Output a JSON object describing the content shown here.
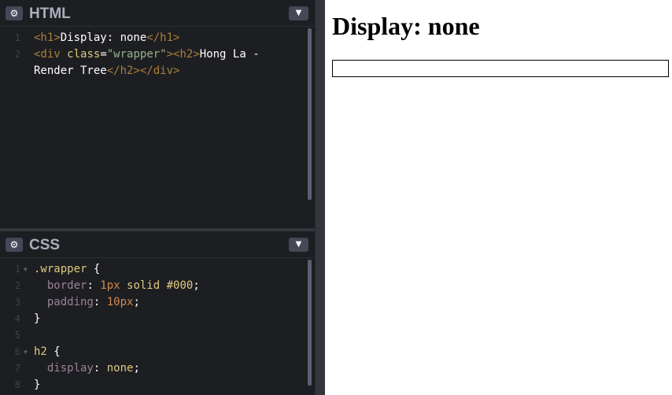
{
  "html_panel": {
    "title": "HTML",
    "gear_icon": "gear-icon",
    "collapse_icon": "chevron-down-icon",
    "lines": [
      {
        "n": "1",
        "segments": [
          {
            "t": "<h1>",
            "c": "tag"
          },
          {
            "t": "Display: none",
            "c": "txt"
          },
          {
            "t": "</h1>",
            "c": "tag"
          }
        ]
      },
      {
        "n": "2",
        "segments": [
          {
            "t": "<div ",
            "c": "tag"
          },
          {
            "t": "class",
            "c": "attr"
          },
          {
            "t": "=",
            "c": "punc"
          },
          {
            "t": "\"wrapper\"",
            "c": "str"
          },
          {
            "t": ">",
            "c": "tag"
          },
          {
            "t": "<h2>",
            "c": "tag"
          },
          {
            "t": "Hong La -",
            "c": "txt"
          }
        ]
      },
      {
        "n": "",
        "segments": [
          {
            "t": "Render Tree",
            "c": "txt"
          },
          {
            "t": "</h2></div>",
            "c": "tag"
          }
        ]
      }
    ]
  },
  "css_panel": {
    "title": "CSS",
    "gear_icon": "gear-icon",
    "collapse_icon": "chevron-down-icon",
    "lines": [
      {
        "n": "1",
        "fold": true,
        "segments": [
          {
            "t": ".wrapper",
            "c": "sel"
          },
          {
            "t": " {",
            "c": "punc"
          }
        ]
      },
      {
        "n": "2",
        "segments": [
          {
            "t": "  border",
            "c": "prop"
          },
          {
            "t": ": ",
            "c": "punc"
          },
          {
            "t": "1px",
            "c": "num"
          },
          {
            "t": " solid #000",
            "c": "val"
          },
          {
            "t": ";",
            "c": "punc"
          }
        ]
      },
      {
        "n": "3",
        "segments": [
          {
            "t": "  padding",
            "c": "prop"
          },
          {
            "t": ": ",
            "c": "punc"
          },
          {
            "t": "10px",
            "c": "num"
          },
          {
            "t": ";",
            "c": "punc"
          }
        ]
      },
      {
        "n": "4",
        "segments": [
          {
            "t": "}",
            "c": "punc"
          }
        ]
      },
      {
        "n": "5",
        "segments": []
      },
      {
        "n": "6",
        "fold": true,
        "segments": [
          {
            "t": "h2",
            "c": "sel"
          },
          {
            "t": " {",
            "c": "punc"
          }
        ]
      },
      {
        "n": "7",
        "segments": [
          {
            "t": "  display",
            "c": "prop"
          },
          {
            "t": ": ",
            "c": "punc"
          },
          {
            "t": "none",
            "c": "val"
          },
          {
            "t": ";",
            "c": "punc"
          }
        ]
      },
      {
        "n": "8",
        "segments": [
          {
            "t": "}",
            "c": "punc"
          }
        ]
      }
    ]
  },
  "result": {
    "heading": "Display: none"
  },
  "colors": {
    "editor_bg": "#1d1e22",
    "tag": "#a88038",
    "attr_value": "#96b38a",
    "selector": "#ddca7e",
    "property": "#9a8297",
    "number": "#d08a4e"
  }
}
